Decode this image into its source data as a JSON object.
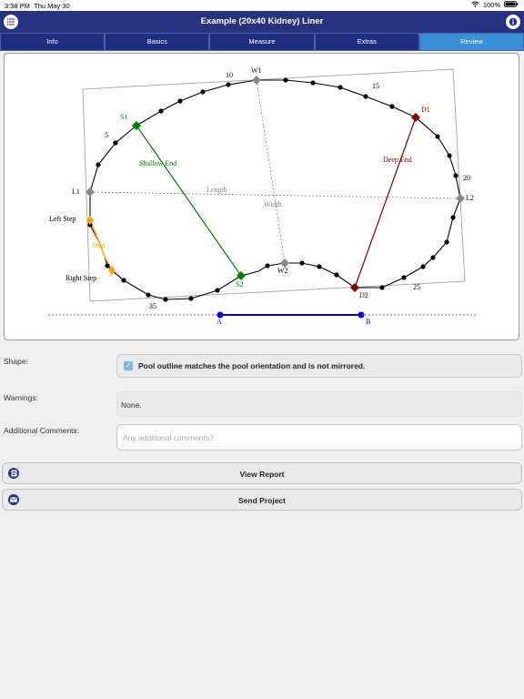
{
  "status": {
    "time": "3:38 PM",
    "date": "Thu May 30",
    "battery": "100%"
  },
  "nav": {
    "title": "Example (20x40 Kidney) Liner"
  },
  "tabs": [
    {
      "label": "Info",
      "active": false
    },
    {
      "label": "Basics",
      "active": false
    },
    {
      "label": "Measure",
      "active": false
    },
    {
      "label": "Extras",
      "active": false
    },
    {
      "label": "Review",
      "active": true
    }
  ],
  "diagram": {
    "labels": {
      "w1": "W1",
      "w2": "W2",
      "s1": "S1",
      "s2": "S2",
      "d1": "D1",
      "d2": "D2",
      "l1": "L1",
      "l2": "L2",
      "a": "A",
      "b": "B",
      "n5": "5",
      "n10": "10",
      "n15": "15",
      "n20": "20",
      "n25": "25",
      "n35": "35",
      "shallow_end": "Shallow End",
      "deep_end": "Deep End",
      "length": "Length",
      "width": "Width",
      "left_step": "Left Step",
      "right_step": "Right Step",
      "step": "Step"
    },
    "colors": {
      "outline": "#000000",
      "shallow": "#008000",
      "deep": "#800000",
      "step": "#ffa500",
      "ab": "#0000e0",
      "measure": "#888888"
    }
  },
  "review": {
    "shape_label": "Shape:",
    "shape_text": "Pool outline matches the pool orientation and is not mirrored.",
    "warnings_label": "Warnings:",
    "warnings_text": "None.",
    "comments_label": "Additional Comments:",
    "comments_placeholder": "Any additional comments?",
    "comments_value": ""
  },
  "actions": {
    "view_report": "View Report",
    "send_project": "Send Project"
  }
}
